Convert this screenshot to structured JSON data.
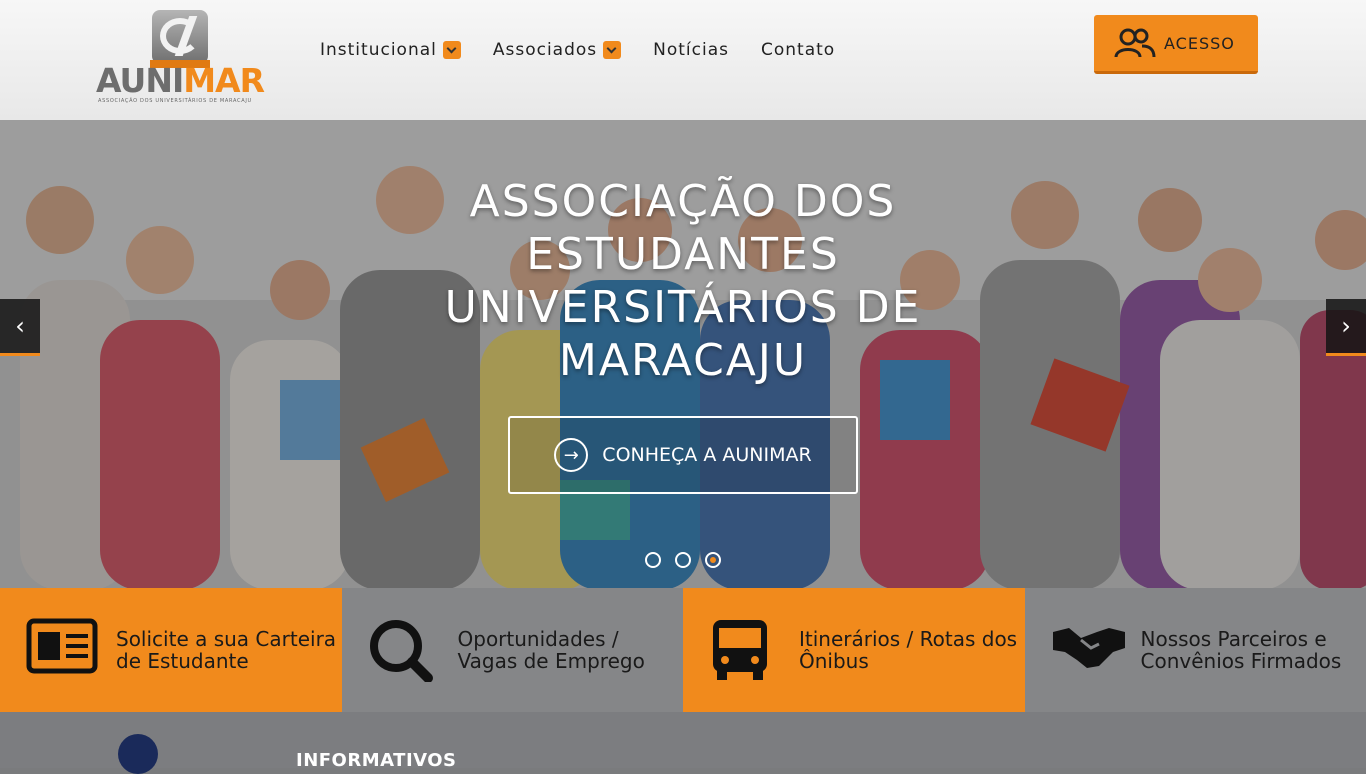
{
  "brand": {
    "name_part1": "AUNI",
    "name_part2": "MAR",
    "tagline": "ASSOCIAÇÃO DOS UNIVERSITÁRIOS DE MARACAJU"
  },
  "nav": {
    "items": [
      {
        "label": "Institucional",
        "has_dropdown": true
      },
      {
        "label": "Associados",
        "has_dropdown": true
      },
      {
        "label": "Notícias",
        "has_dropdown": false
      },
      {
        "label": "Contato",
        "has_dropdown": false
      }
    ]
  },
  "access_button": {
    "label": "ACESSO",
    "icon": "users-icon"
  },
  "hero": {
    "title": "ASSOCIAÇÃO DOS ESTUDANTES UNIVERSITÁRIOS DE MARACAJU",
    "cta_label": "CONHEÇA A AUNIMAR",
    "prev_icon": "‹",
    "next_icon": "›",
    "slides_count": 3,
    "active_slide": 3
  },
  "tiles": [
    {
      "label": "Solicite a sua Carteira de Estudante",
      "icon": "id-card-icon",
      "color": "#f18a1c"
    },
    {
      "label": "Oportunidades / Vagas de Emprego",
      "icon": "search-icon",
      "color": "#858688"
    },
    {
      "label": "Itinerários / Rotas dos Ônibus",
      "icon": "bus-icon",
      "color": "#f18a1c"
    },
    {
      "label": "Nossos Parceiros e Convênios Firmados",
      "icon": "handshake-icon",
      "color": "#858688"
    }
  ],
  "section": {
    "title": "INFORMATIVOS"
  },
  "colors": {
    "accent": "#f18a1c",
    "grey": "#858688"
  }
}
